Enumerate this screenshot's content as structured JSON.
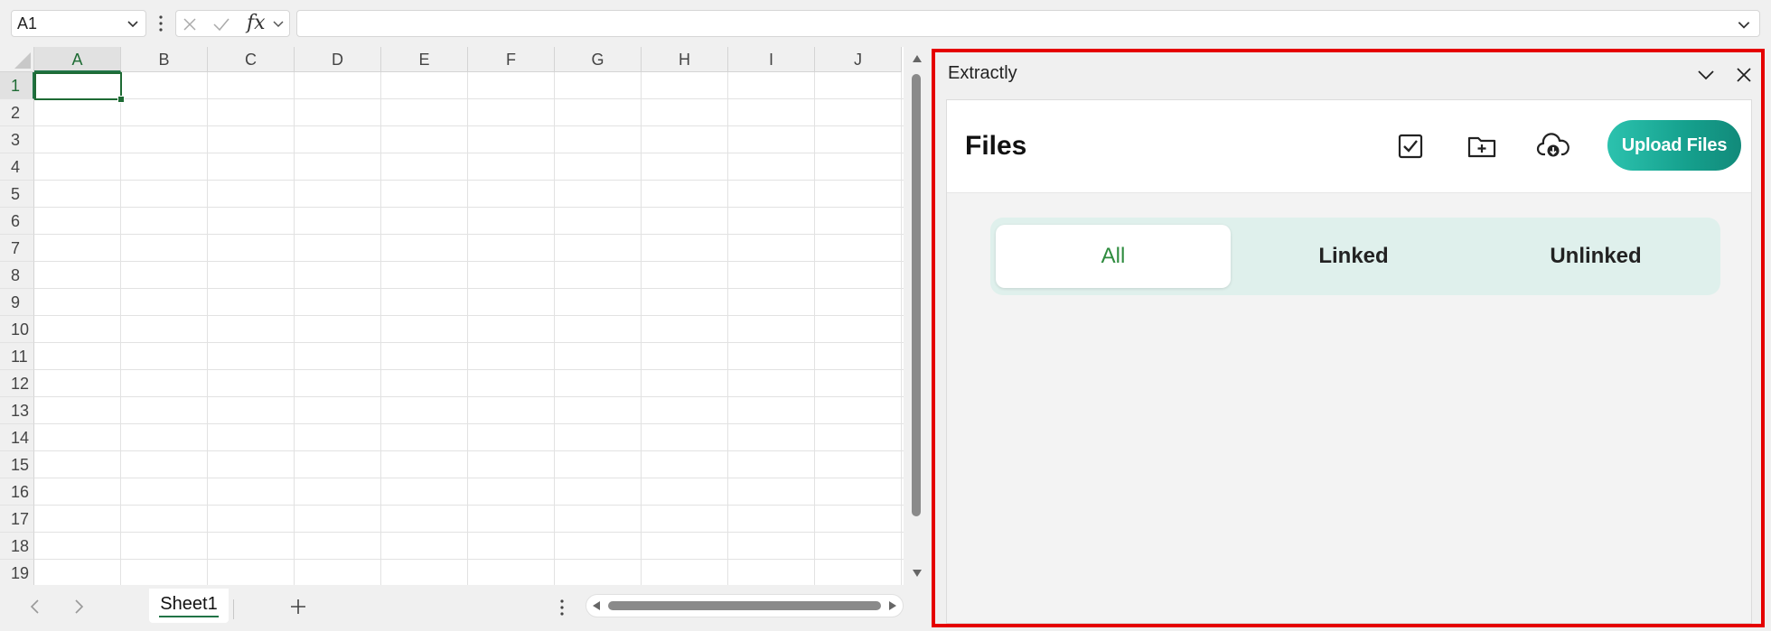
{
  "formula_bar": {
    "name_box_value": "A1",
    "fx_label": "fx",
    "formula_value": ""
  },
  "grid": {
    "columns": [
      "A",
      "B",
      "C",
      "D",
      "E",
      "F",
      "G",
      "H",
      "I",
      "J"
    ],
    "rows": [
      "1",
      "2",
      "3",
      "4",
      "5",
      "6",
      "7",
      "8",
      "9",
      "10",
      "11",
      "12",
      "13",
      "14",
      "15",
      "16",
      "17",
      "18",
      "19"
    ],
    "selected_column": "A",
    "selected_row": "1"
  },
  "sheet_tabs": {
    "tabs": [
      "Sheet1"
    ],
    "active": "Sheet1"
  },
  "task_pane": {
    "title": "Extractly",
    "files_title": "Files",
    "upload_label": "Upload Files",
    "filters": [
      "All",
      "Linked",
      "Unlinked"
    ],
    "active_filter": "All"
  },
  "colors": {
    "excel_green": "#217346",
    "upload_gradient_start": "#2cc2ae",
    "upload_gradient_end": "#128a7a",
    "segment_bg": "#dff0ec",
    "active_filter_text": "#2e8b3e",
    "highlight_border": "#e50000"
  },
  "icons": {
    "collapse": "chevron-down-icon",
    "close": "close-icon",
    "select": "checkbox-icon",
    "new_folder": "folder-plus-icon",
    "cloud": "cloud-download-icon"
  }
}
